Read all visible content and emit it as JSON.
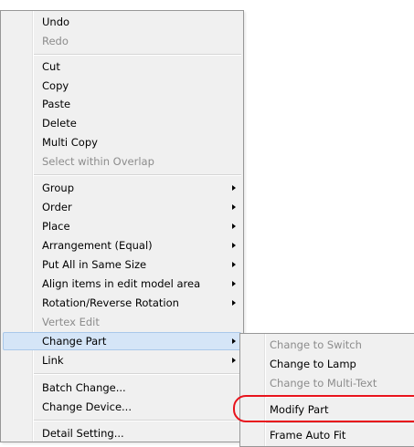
{
  "menu": {
    "items": [
      {
        "label": "Undo",
        "disabled": false
      },
      {
        "label": "Redo",
        "disabled": true
      },
      {
        "label": "Cut",
        "disabled": false
      },
      {
        "label": "Copy",
        "disabled": false
      },
      {
        "label": "Paste",
        "disabled": false
      },
      {
        "label": "Delete",
        "disabled": false
      },
      {
        "label": "Multi Copy",
        "disabled": false
      },
      {
        "label": "Select within Overlap",
        "disabled": true
      },
      {
        "label": "Group",
        "disabled": false,
        "submenu": true
      },
      {
        "label": "Order",
        "disabled": false,
        "submenu": true
      },
      {
        "label": "Place",
        "disabled": false,
        "submenu": true
      },
      {
        "label": "Arrangement (Equal)",
        "disabled": false,
        "submenu": true
      },
      {
        "label": "Put All in Same Size",
        "disabled": false,
        "submenu": true
      },
      {
        "label": "Align items in edit model area",
        "disabled": false,
        "submenu": true
      },
      {
        "label": "Rotation/Reverse Rotation",
        "disabled": false,
        "submenu": true
      },
      {
        "label": "Vertex Edit",
        "disabled": true
      },
      {
        "label": "Change Part",
        "disabled": false,
        "submenu": true,
        "highlighted": true
      },
      {
        "label": "Link",
        "disabled": false,
        "submenu": true
      },
      {
        "label": "Batch Change...",
        "disabled": false
      },
      {
        "label": "Change Device...",
        "disabled": false
      },
      {
        "label": "Detail Setting...",
        "disabled": false
      }
    ]
  },
  "submenu": {
    "items": [
      {
        "label": "Change to Switch",
        "disabled": true
      },
      {
        "label": "Change to Lamp",
        "disabled": false
      },
      {
        "label": "Change to Multi-Text",
        "disabled": true
      },
      {
        "label": "Modify Part",
        "disabled": false,
        "circled": true
      },
      {
        "label": "Frame Auto Fit",
        "disabled": false
      }
    ]
  },
  "colors": {
    "menu_bg": "#f0f0f0",
    "highlight_bg": "#d5e5f7",
    "disabled_text": "#8c8c8c",
    "annotation_ring": "#e8131c"
  }
}
